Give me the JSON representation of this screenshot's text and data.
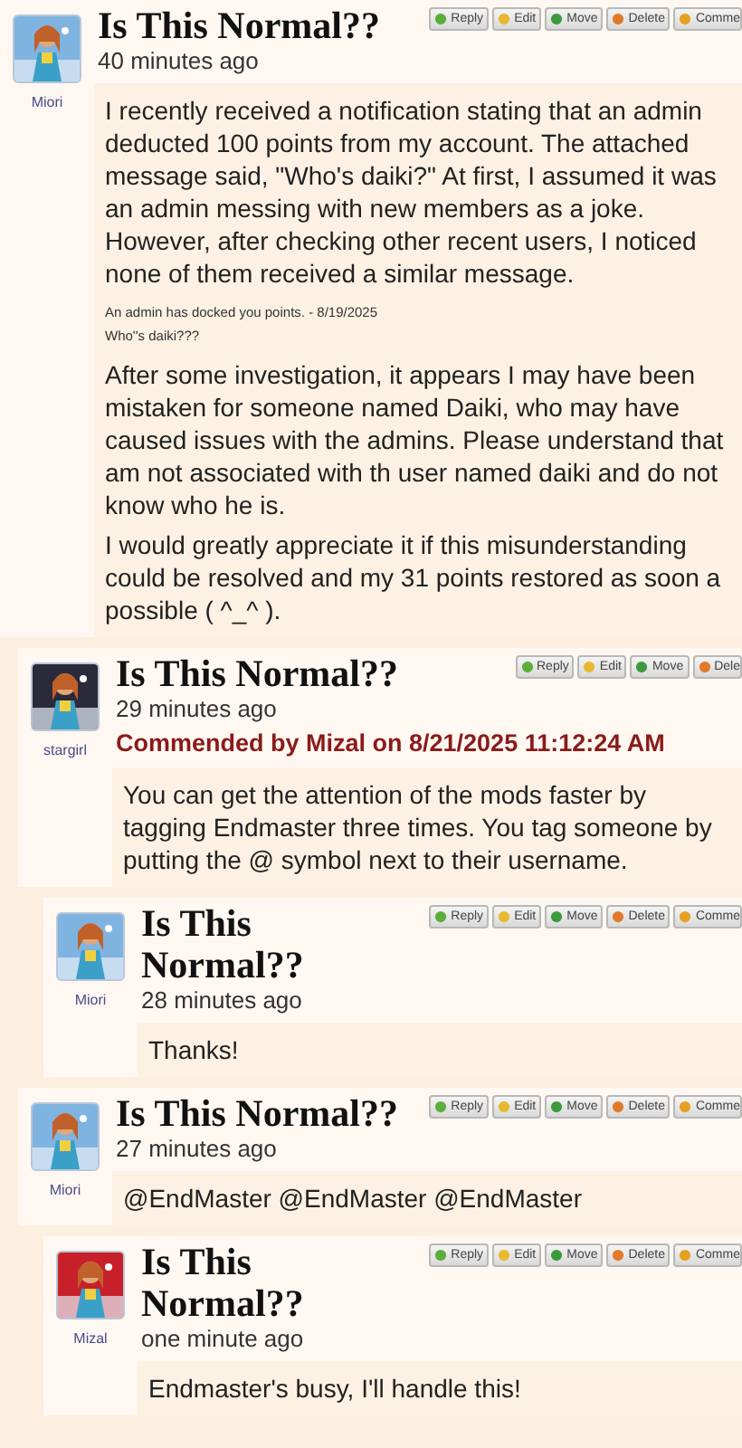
{
  "posts": [
    {
      "user": "Miori",
      "title": "Is This Normal??",
      "time": "40 minutes ago",
      "buttons": [
        "Reply",
        "Edit",
        "Move",
        "Delete",
        "Comme"
      ],
      "body": [
        {
          "kind": "text",
          "text": "I recently received a notification stating that an admin deducted 100 points from my account. The attached message said, \"Who's daiki?\" At first, I assumed it was an admin messing with new members as a joke. However, after checking other recent users, I noticed none of them received a similar message."
        },
        {
          "kind": "quote",
          "text": "An admin has docked you points. - 8/19/2025"
        },
        {
          "kind": "quote",
          "text": "Who''s daiki???"
        },
        {
          "kind": "text",
          "text": "After some investigation, it appears I may have been mistaken for someone named Daiki, who may have caused issues with the admins. Please understand that am not associated with th user named daiki and do not know who he is."
        },
        {
          "kind": "text",
          "text": "I would greatly appreciate it if this misunderstanding could be resolved and my 31 points restored as soon a possible ( ^_^ )."
        }
      ],
      "children": [
        {
          "user": "stargirl",
          "title": "Is This Normal??",
          "time": "29 minutes ago",
          "buttons": [
            "Reply",
            "Edit",
            "Move",
            "Dele"
          ],
          "commendation": "Commended by Mizal on 8/21/2025 11:12:24 AM",
          "body": [
            {
              "kind": "text",
              "text": "You can get the attention of the mods faster by tagging Endmaster three times. You tag someone by putting the @ symbol next to their username."
            }
          ],
          "children": [
            {
              "user": "Miori",
              "title": "Is This Normal??",
              "time": "28 minutes ago",
              "buttons": [
                "Reply",
                "Edit",
                "Move",
                "Delete",
                "Comme"
              ],
              "body": [
                {
                  "kind": "text",
                  "text": "Thanks!"
                }
              ]
            }
          ]
        },
        {
          "user": "Miori",
          "title": "Is This Normal??",
          "time": "27 minutes ago",
          "buttons": [
            "Reply",
            "Edit",
            "Move",
            "Delete",
            "Comme"
          ],
          "body": [
            {
              "kind": "text",
              "text": "@EndMaster @EndMaster @EndMaster"
            }
          ],
          "children": [
            {
              "user": "Mizal",
              "title": "Is This Normal??",
              "time": "one minute ago",
              "buttons": [
                "Reply",
                "Edit",
                "Move",
                "Delete",
                "Comme"
              ],
              "body": [
                {
                  "kind": "text",
                  "text": "Endmaster's busy, I'll handle this!"
                }
              ]
            }
          ]
        }
      ]
    }
  ]
}
